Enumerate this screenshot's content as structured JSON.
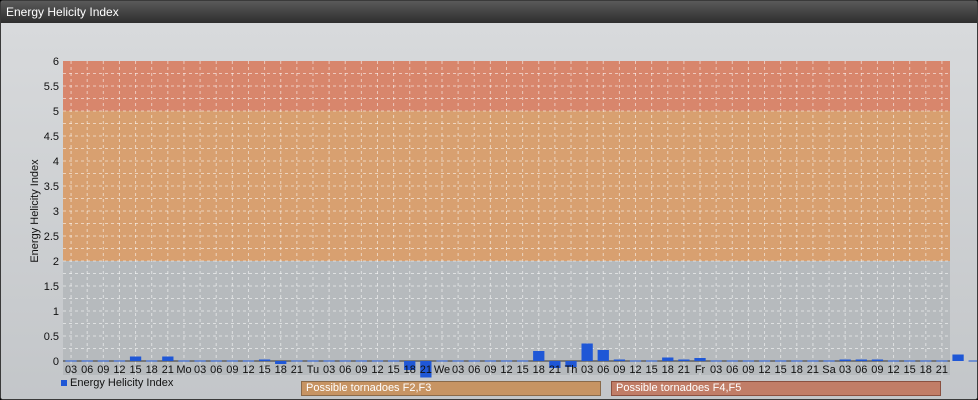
{
  "window": {
    "title": "Energy Helicity Index"
  },
  "legend": {
    "label": "Energy Helicity Index",
    "color": "#1f57d6"
  },
  "warnings": [
    {
      "label": "Possible tornadoes F2,F3"
    },
    {
      "label": "Possible tornadoes F4,F5"
    }
  ],
  "chart_data": {
    "type": "bar",
    "title": "",
    "ylabel": "Energy Helicity Index",
    "xlabel": "",
    "ylim": [
      -0.35,
      6
    ],
    "yticks": [
      0,
      0.5,
      1,
      1.5,
      2,
      2.5,
      3,
      3.5,
      4,
      4.5,
      5,
      5.5,
      6
    ],
    "grid": true,
    "legend_position": "bottom-left",
    "bands": [
      {
        "from": 0,
        "to": 2,
        "color": "#b6babd"
      },
      {
        "from": 2,
        "to": 5,
        "color": "#d8a070"
      },
      {
        "from": 5,
        "to": 6,
        "color": "#d8866c"
      }
    ],
    "categories": [
      "03",
      "06",
      "09",
      "12",
      "15",
      "18",
      "21",
      "Mo",
      "03",
      "06",
      "09",
      "12",
      "15",
      "18",
      "21",
      "Tu",
      "03",
      "06",
      "09",
      "12",
      "15",
      "18",
      "21",
      "We",
      "03",
      "06",
      "09",
      "12",
      "15",
      "18",
      "21",
      "Th",
      "03",
      "06",
      "09",
      "12",
      "15",
      "18",
      "21",
      "Fr",
      "03",
      "06",
      "09",
      "12",
      "15",
      "18",
      "21",
      "Sa",
      "03",
      "06",
      "09",
      "12",
      "15",
      "18",
      "21"
    ],
    "series": [
      {
        "name": "Energy Helicity Index",
        "color": "#1f57d6",
        "values": [
          0.01,
          0.01,
          0.01,
          0.01,
          0.09,
          0.01,
          0.09,
          0.01,
          0.01,
          0.01,
          0.01,
          0.01,
          0.03,
          -0.06,
          0.01,
          0.01,
          0.01,
          0.01,
          0.01,
          0.01,
          0.01,
          -0.18,
          -0.33,
          0.01,
          0.01,
          0.01,
          0.01,
          0.01,
          0.01,
          0.2,
          -0.14,
          -0.12,
          0.35,
          0.22,
          0.03,
          0.01,
          0.01,
          0.07,
          0.03,
          0.06,
          0.01,
          0.01,
          0.01,
          0.01,
          0.01,
          0.01,
          0.01,
          0.01,
          0.03,
          0.03,
          0.03,
          0.01,
          0.01,
          0.01,
          0.01,
          0.13,
          0.01,
          0.01
        ]
      }
    ]
  }
}
